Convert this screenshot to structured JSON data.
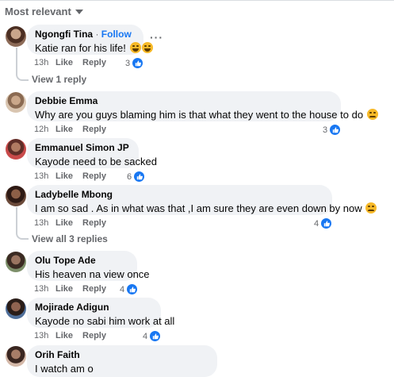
{
  "sort_label": "Most relevant",
  "colors": {
    "accent": "#1877f2",
    "bubble": "#f0f2f5",
    "meta": "#65676b"
  },
  "comments": [
    {
      "name": "Ngongfi Tina",
      "follow": "Follow",
      "text": "Katie ran for his life!",
      "emoji": "laughing-emoji",
      "time": "13h",
      "like": "Like",
      "reply": "Reply",
      "reactions": "3",
      "more": "···"
    },
    {
      "name": "Debbie Emma",
      "text": "Why are you guys blaming him is that what they went to the house to do",
      "emoji": "sad-emoji",
      "time": "12h",
      "like": "Like",
      "reply": "Reply",
      "reactions": "3"
    },
    {
      "name": "Emmanuel Simon JP",
      "text": "Kayode need to be sacked",
      "time": "13h",
      "like": "Like",
      "reply": "Reply",
      "reactions": "6"
    },
    {
      "name": "Ladybelle Mbong",
      "text": "I am so sad . As in what was that ,I am sure they are even down by now",
      "emoji": "sad-emoji",
      "time": "13h",
      "like": "Like",
      "reply": "Reply",
      "reactions": "4"
    },
    {
      "name": "Olu Tope Ade",
      "text": "His heaven na view once",
      "time": "13h",
      "like": "Like",
      "reply": "Reply",
      "reactions": "4"
    },
    {
      "name": "Mojirade Adigun",
      "text": "Kayode no sabi him work at all",
      "time": "13h",
      "like": "Like",
      "reply": "Reply",
      "reactions": "4"
    },
    {
      "name": "Orih Faith",
      "text": "I watch am o"
    }
  ],
  "view_replies": [
    "View 1 reply",
    "View all 3 replies"
  ]
}
